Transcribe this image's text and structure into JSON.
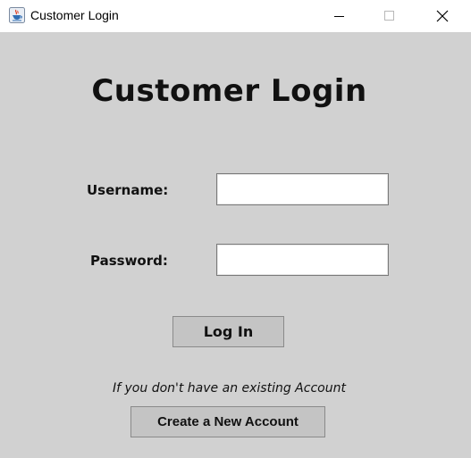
{
  "window": {
    "title": "Customer Login",
    "icon": "java-cup-icon",
    "controls": [
      "minimize",
      "maximize",
      "close"
    ]
  },
  "form": {
    "heading": "Customer Login",
    "username_label": "Username:",
    "username_value": "",
    "password_label": "Password:",
    "password_value": "",
    "login_button": "Log In",
    "hint_text": "If you don't have an existing Account",
    "create_button": "Create a New Account"
  },
  "colors": {
    "background": "#d1d1d1",
    "button": "#c4c4c4",
    "titlebar": "#ffffff"
  }
}
